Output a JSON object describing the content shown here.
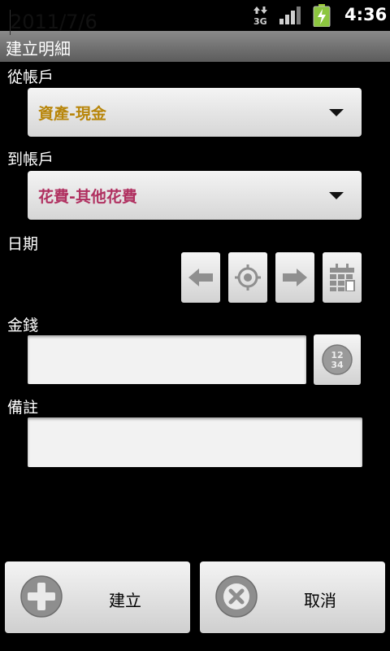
{
  "status_bar": {
    "network": "3G",
    "time": "4:36"
  },
  "title": "建立明細",
  "from_account": {
    "label": "從帳戶",
    "value": "資產-現金",
    "color": "#b8860b"
  },
  "to_account": {
    "label": "到帳戶",
    "value": "花費-其他花費",
    "color": "#b03060"
  },
  "date": {
    "label": "日期",
    "value": "2011/7/6"
  },
  "amount": {
    "label": "金錢",
    "value": ""
  },
  "note": {
    "label": "備註",
    "value": ""
  },
  "icons": {
    "prev_date": "arrow-left-icon",
    "today": "target-icon",
    "next_date": "arrow-right-icon",
    "calendar": "calendar-icon",
    "calculator": "calculator-icon"
  },
  "calculator_icon_text": "1234",
  "buttons": {
    "create": "建立",
    "cancel": "取消"
  },
  "colors": {
    "focus": "#f0a01d",
    "titlebar": "#6e6e6e"
  }
}
